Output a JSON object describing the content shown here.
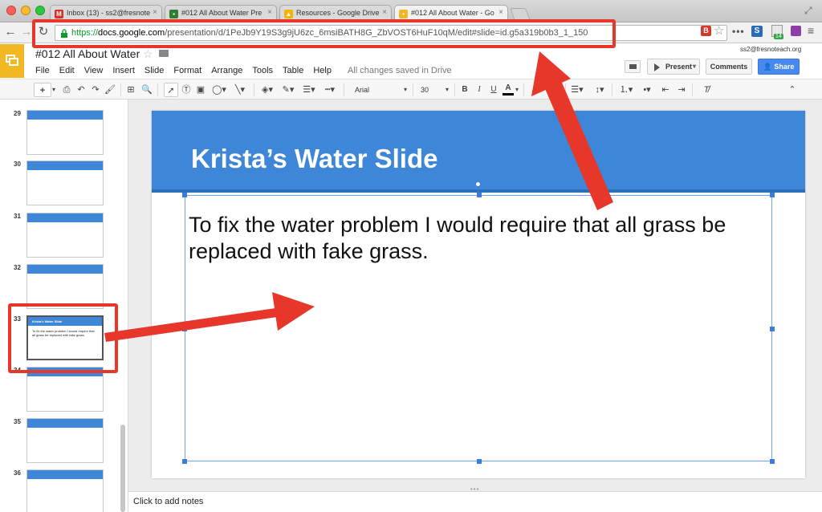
{
  "browser": {
    "tabs": [
      {
        "label": "Inbox (13) - ss2@fresnote",
        "favicon": "gmail-icon",
        "favicon_color": "#d93025",
        "active": false
      },
      {
        "label": "#012 All About Water Pre",
        "favicon": "slides-icon",
        "favicon_color": "#2e7d32",
        "active": false
      },
      {
        "label": "Resources - Google Drive",
        "favicon": "drive-icon",
        "favicon_color": "#f4b400",
        "active": false
      },
      {
        "label": "#012 All About Water - Go",
        "favicon": "slides-icon",
        "favicon_color": "#f2b824",
        "active": true
      }
    ],
    "url_scheme": "https://",
    "url_host": "docs.google.com",
    "url_path": "/presentation/d/1PeJb9Y19S3g9jU6zc_6msiBATH8G_ZbVOST6HuF10qM/edit#slide=id.g5a319b0b3_1_150",
    "ext_b": "B",
    "ext_s": "S",
    "ext_cal_badge": "14"
  },
  "app": {
    "doc_title": "#012 All About Water",
    "menu": [
      "File",
      "Edit",
      "View",
      "Insert",
      "Slide",
      "Format",
      "Arrange",
      "Tools",
      "Table",
      "Help"
    ],
    "save_status": "All changes saved in Drive",
    "user_email": "ss2@fresnoteach.org",
    "present_label": "Present",
    "comments_label": "Comments",
    "share_label": "Share"
  },
  "toolbar": {
    "font_name": "Arial",
    "font_size": "30",
    "bold": "B",
    "italic": "I",
    "underline": "U",
    "text_color": "A"
  },
  "filmstrip": {
    "slides": [
      {
        "num": "29"
      },
      {
        "num": "30"
      },
      {
        "num": "31"
      },
      {
        "num": "32"
      },
      {
        "num": "33",
        "title": "Krista's Water Slide",
        "body": "To fix the water problem I would require that all grass be replaced with fake grass."
      },
      {
        "num": "34"
      },
      {
        "num": "35"
      },
      {
        "num": "36"
      }
    ]
  },
  "slide": {
    "title": "Krista’s Water Slide",
    "body": "To fix the water problem I would require that all grass be replaced with fake grass."
  },
  "notes_placeholder": "Click to add notes",
  "colors": {
    "accent_blue": "#3d86d8",
    "annotation_red": "#e6372a",
    "slides_yellow": "#f2b824",
    "share_blue": "#4889f1"
  }
}
